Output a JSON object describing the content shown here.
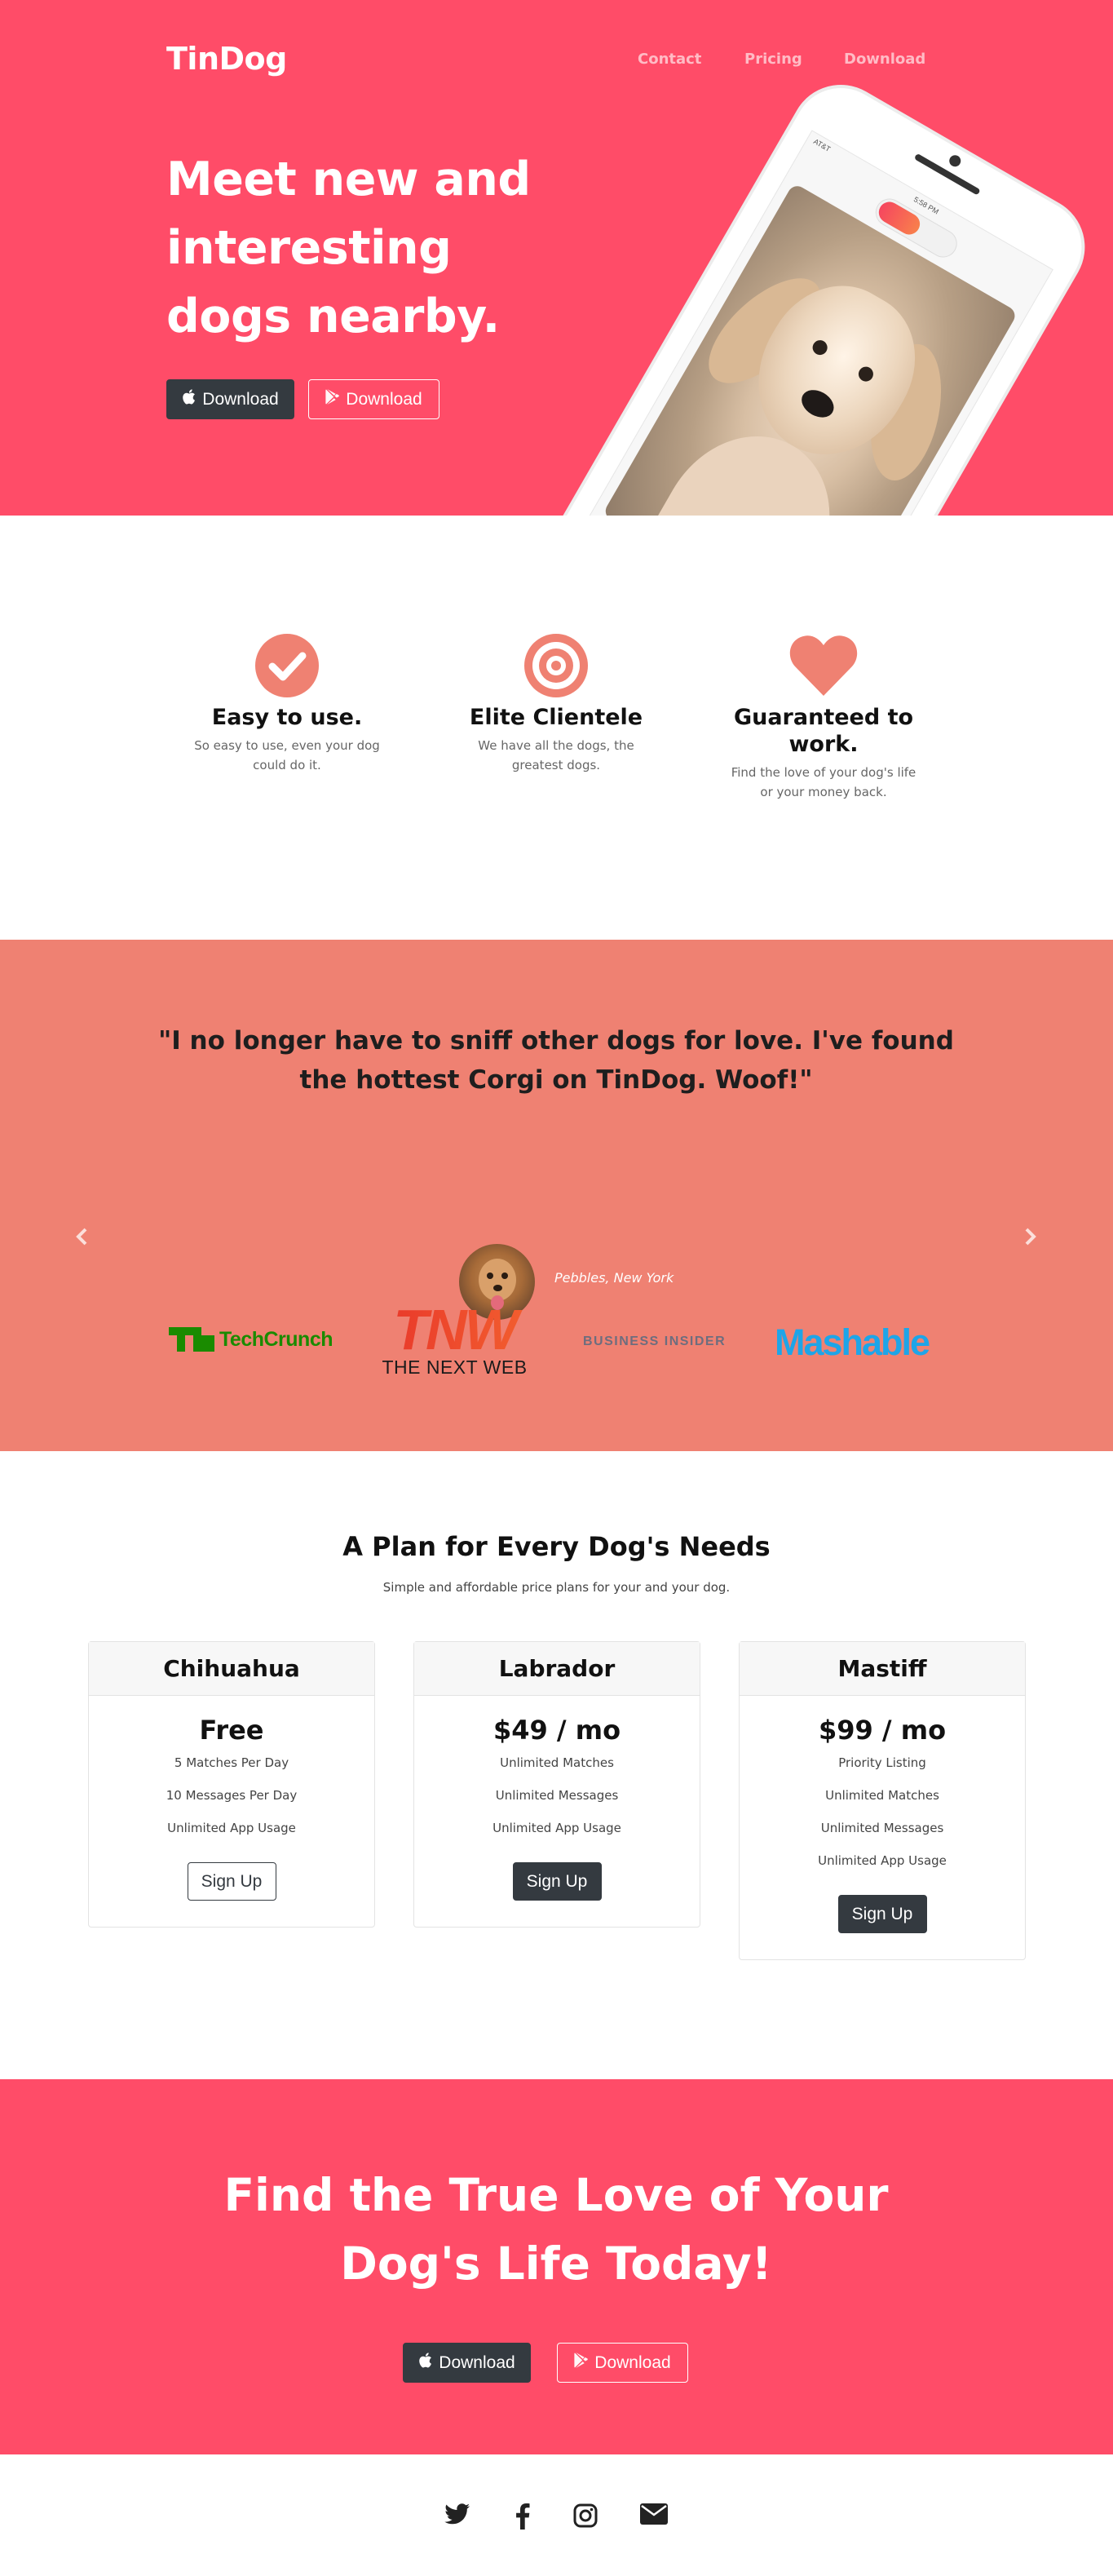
{
  "nav": {
    "brand": "TinDog",
    "links": [
      "Contact",
      "Pricing",
      "Download"
    ]
  },
  "hero": {
    "title": "Meet new and interesting dogs nearby.",
    "apple_button": "Download",
    "google_button": "Download",
    "phone": {
      "carrier": "AT&T",
      "time": "5:58 PM"
    }
  },
  "features": [
    {
      "icon": "check-circle-icon",
      "title": "Easy to use.",
      "text": "So easy to use, even your dog could do it."
    },
    {
      "icon": "bullseye-icon",
      "title": "Elite Clientele",
      "text": "We have all the dogs, the greatest dogs."
    },
    {
      "icon": "heart-icon",
      "title": "Guaranteed to work.",
      "text": "Find the love of your dog's life or your money back."
    }
  ],
  "testimonial": {
    "quote": "\"I no longer have to sniff other dogs for love. I've found the hottest Corgi on TinDog. Woof!\"",
    "attribution": "Pebbles, New York",
    "prev_icon": "chevron-left-icon",
    "next_icon": "chevron-right-icon"
  },
  "press": {
    "techcrunch": "TechCrunch",
    "tnw_mark": "TNW",
    "tnw_text": "THE NEXT WEB",
    "business_insider": "BUSINESS INSIDER",
    "mashable": "Mashable"
  },
  "pricing": {
    "title": "A Plan for Every Dog's Needs",
    "subtitle": "Simple and affordable price plans for your and your dog.",
    "plans": [
      {
        "name": "Chihuahua",
        "price": "Free",
        "features": [
          "5 Matches Per Day",
          "10 Messages Per Day",
          "Unlimited App Usage"
        ],
        "button": "Sign Up",
        "style": "outline"
      },
      {
        "name": "Labrador",
        "price": "$49 / mo",
        "features": [
          "Unlimited Matches",
          "Unlimited Messages",
          "Unlimited App Usage"
        ],
        "button": "Sign Up",
        "style": "dark"
      },
      {
        "name": "Mastiff",
        "price": "$99 / mo",
        "features": [
          "Priority Listing",
          "Unlimited Matches",
          "Unlimited Messages",
          "Unlimited App Usage"
        ],
        "button": "Sign Up",
        "style": "dark"
      }
    ]
  },
  "cta": {
    "title": "Find the True Love of Your Dog's Life Today!",
    "apple_button": "Download",
    "google_button": "Download"
  },
  "footer": {
    "social_icons": [
      "twitter-icon",
      "facebook-icon",
      "instagram-icon",
      "envelope-icon"
    ]
  },
  "colors": {
    "brand_red": "#ff4c68",
    "coral": "#ef8172",
    "dark": "#343a40"
  }
}
